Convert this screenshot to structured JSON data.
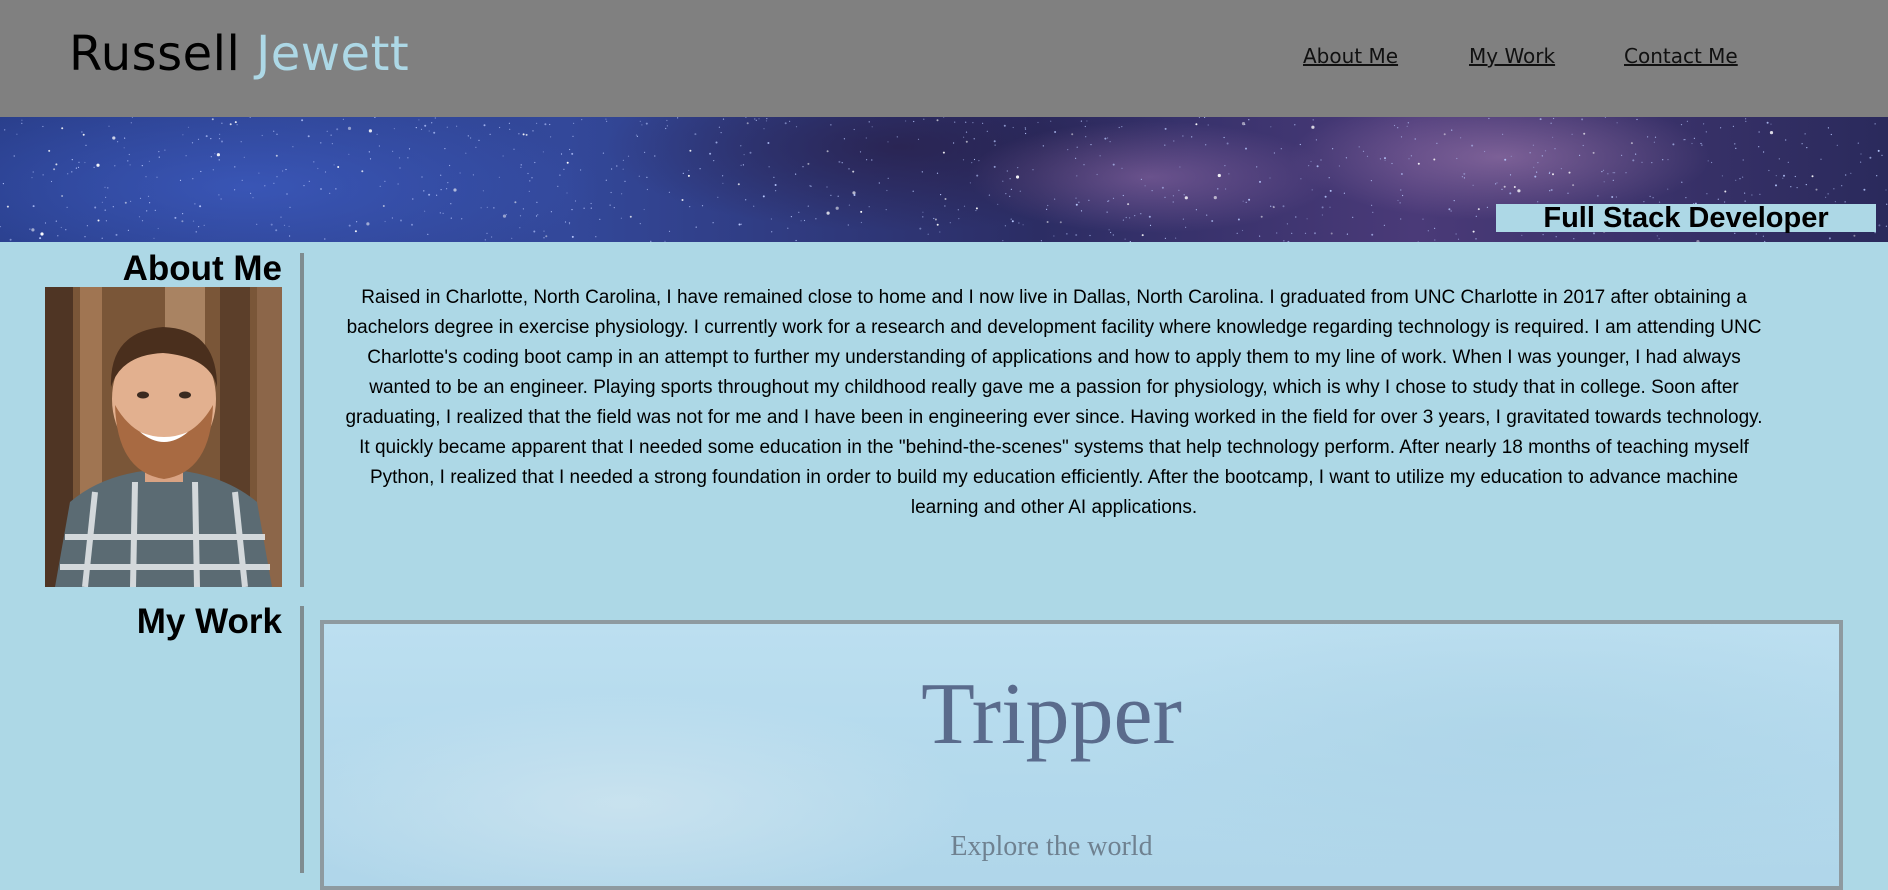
{
  "header": {
    "brand_first": "Russell",
    "brand_last": "Jewett",
    "nav": [
      "About Me",
      "My Work",
      "Contact Me"
    ]
  },
  "hero": {
    "tagline": "Full Stack Developer"
  },
  "about": {
    "heading": "About Me",
    "bio": "Raised in Charlotte, North Carolina, I have remained close to home and I now live in Dallas, North Carolina. I graduated from UNC Charlotte in 2017 after obtaining a bachelors degree in exercise physiology. I currently work for a research and development facility where knowledge regarding technology is required. I am attending UNC Charlotte's coding boot camp in an attempt to further my understanding of applications and how to apply them to my line of work. When I was younger, I had always wanted to be an engineer. Playing sports throughout my childhood really gave me a passion for physiology, which is why I chose to study that in college. Soon after graduating, I realized that the field was not for me and I have been in engineering ever since. Having worked in the field for over 3 years, I gravitated towards technology. It quickly became apparent that I needed some education in the \"behind-the-scenes\" systems that help technology perform. After nearly 18 months of teaching myself Python, I realized that I needed a strong foundation in order to build my education efficiently. After the bootcamp, I want to utilize my education to advance machine learning and other AI applications."
  },
  "work": {
    "heading": "My Work",
    "projects": [
      {
        "title": "Tripper",
        "subtitle": "Explore the world"
      }
    ]
  },
  "colors": {
    "header_bg": "#808080",
    "page_bg": "#add8e6",
    "brand_accent": "#add8e6"
  }
}
